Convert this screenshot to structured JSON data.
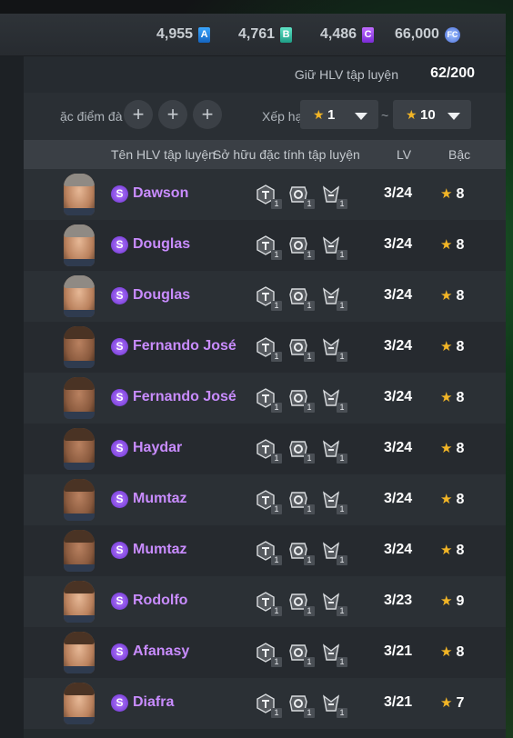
{
  "currencies": [
    {
      "value": "4,955",
      "badge": "A",
      "color": "#2f8cff"
    },
    {
      "value": "4,761",
      "badge": "B",
      "color": "#2fc7a6"
    },
    {
      "value": "4,486",
      "badge": "C",
      "color": "#9b4bff"
    },
    {
      "value": "66,000",
      "badge": "FC",
      "color": "#5f86e6"
    }
  ],
  "hold": {
    "label": "Giữ HLV tập luyện",
    "value": "62/200"
  },
  "filters": {
    "trait_label": "ặc điểm đà",
    "rank_label": "Xếp hạ",
    "min_rank": "1",
    "max_rank": "10",
    "separator": "~"
  },
  "table": {
    "headers": {
      "name": "Tên HLV tập luyện",
      "traits": "Sở hữu đặc tính tập luyện",
      "lv": "LV",
      "grade": "Bậc"
    },
    "rows": [
      {
        "name": "Dawson",
        "lv": "3/24",
        "grade": "8",
        "traits": [
          "1",
          "1",
          "1"
        ]
      },
      {
        "name": "Douglas",
        "lv": "3/24",
        "grade": "8",
        "traits": [
          "1",
          "1",
          "1"
        ]
      },
      {
        "name": "Douglas",
        "lv": "3/24",
        "grade": "8",
        "traits": [
          "1",
          "1",
          "1"
        ]
      },
      {
        "name": "Fernando José",
        "lv": "3/24",
        "grade": "8",
        "traits": [
          "1",
          "1",
          "1"
        ]
      },
      {
        "name": "Fernando José",
        "lv": "3/24",
        "grade": "8",
        "traits": [
          "1",
          "1",
          "1"
        ]
      },
      {
        "name": "Haydar",
        "lv": "3/24",
        "grade": "8",
        "traits": [
          "1",
          "1",
          "1"
        ]
      },
      {
        "name": "Mumtaz",
        "lv": "3/24",
        "grade": "8",
        "traits": [
          "1",
          "1",
          "1"
        ]
      },
      {
        "name": "Mumtaz",
        "lv": "3/24",
        "grade": "8",
        "traits": [
          "1",
          "1",
          "1"
        ]
      },
      {
        "name": "Rodolfo",
        "lv": "3/23",
        "grade": "9",
        "traits": [
          "1",
          "1",
          "1"
        ]
      },
      {
        "name": "Afanasy",
        "lv": "3/21",
        "grade": "8",
        "traits": [
          "1",
          "1",
          "1"
        ]
      },
      {
        "name": "Diafra",
        "lv": "3/21",
        "grade": "7",
        "traits": [
          "1",
          "1",
          "1"
        ]
      }
    ]
  },
  "icons": {
    "grade_star": "star-icon",
    "season_badge": "S",
    "add": "+"
  },
  "colors": {
    "name_purple": "#c98cff",
    "star_gold": "#f2b526"
  }
}
